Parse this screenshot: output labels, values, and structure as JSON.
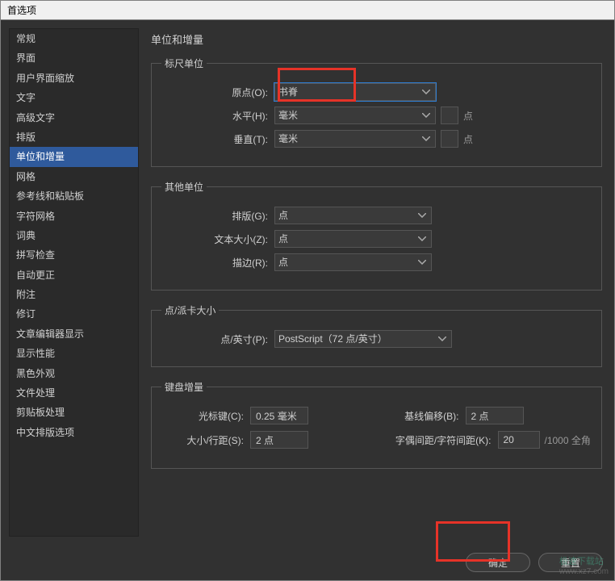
{
  "window": {
    "title": "首选项"
  },
  "sidebar": {
    "items": [
      {
        "label": "常规"
      },
      {
        "label": "界面"
      },
      {
        "label": "用户界面缩放"
      },
      {
        "label": "文字"
      },
      {
        "label": "高级文字"
      },
      {
        "label": "排版"
      },
      {
        "label": "单位和增量",
        "selected": true
      },
      {
        "label": "网格"
      },
      {
        "label": "参考线和粘贴板"
      },
      {
        "label": "字符网格"
      },
      {
        "label": "词典"
      },
      {
        "label": "拼写检查"
      },
      {
        "label": "自动更正"
      },
      {
        "label": "附注"
      },
      {
        "label": "修订"
      },
      {
        "label": "文章编辑器显示"
      },
      {
        "label": "显示性能"
      },
      {
        "label": "黑色外观"
      },
      {
        "label": "文件处理"
      },
      {
        "label": "剪贴板处理"
      },
      {
        "label": "中文排版选项"
      }
    ]
  },
  "page": {
    "title": "单位和增量",
    "ruler_units": {
      "legend": "标尺单位",
      "origin_label": "原点(O):",
      "origin_value": "书脊",
      "horizontal_label": "水平(H):",
      "horizontal_value": "毫米",
      "vertical_label": "垂直(T):",
      "vertical_value": "毫米",
      "suffix": "点"
    },
    "other_units": {
      "legend": "其他单位",
      "typesetting_label": "排版(G):",
      "typesetting_value": "点",
      "textsize_label": "文本大小(Z):",
      "textsize_value": "点",
      "stroke_label": "描边(R):",
      "stroke_value": "点"
    },
    "point_pica": {
      "legend": "点/派卡大小",
      "label": "点/英寸(P):",
      "value": "PostScript（72 点/英寸）"
    },
    "keyboard_increments": {
      "legend": "键盘增量",
      "cursor_label": "光标键(C):",
      "cursor_value": "0.25 毫米",
      "baseline_label": "基线偏移(B):",
      "baseline_value": "2 点",
      "size_leading_label": "大小/行距(S):",
      "size_leading_value": "2 点",
      "kerning_label": "字偶间距/字符间距(K):",
      "kerning_value": "20",
      "kerning_suffix": "/1000 全角"
    }
  },
  "buttons": {
    "ok": "确定",
    "cancel": "重置"
  },
  "watermark": {
    "line1": "极速下载站",
    "line2": "www.xz7.com"
  }
}
